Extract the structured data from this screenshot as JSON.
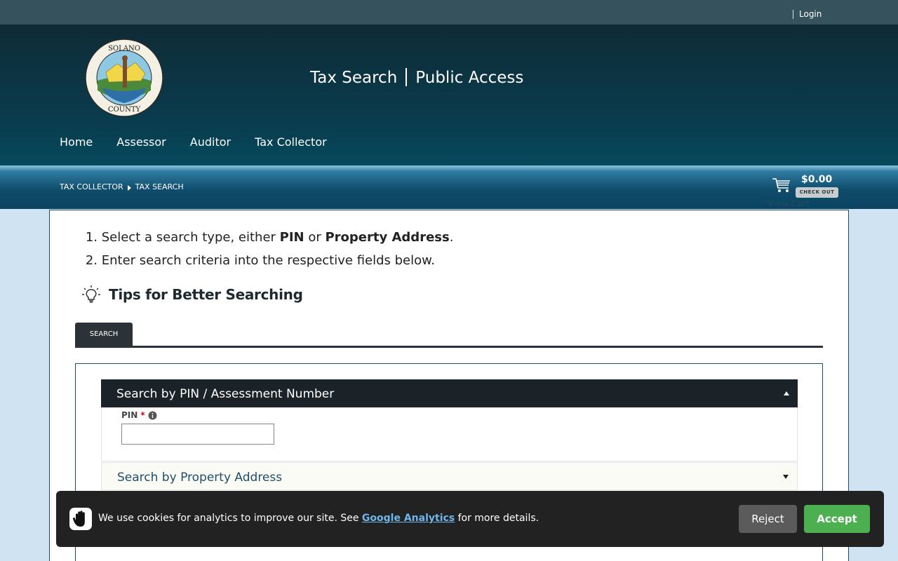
{
  "topbar": {
    "login_label": "Login"
  },
  "header": {
    "title_left": "Tax Search",
    "title_right": "Public Access",
    "logo_text_top": "SOLANO",
    "logo_text_bottom": "COUNTY"
  },
  "nav": {
    "items": [
      {
        "label": "Home"
      },
      {
        "label": "Assessor"
      },
      {
        "label": "Auditor"
      },
      {
        "label": "Tax Collector"
      }
    ]
  },
  "breadcrumb": {
    "items": [
      {
        "label": "TAX COLLECTOR"
      },
      {
        "label": "TAX SEARCH"
      }
    ]
  },
  "cart": {
    "amount": "$0.00",
    "checkout_label": "CHECK OUT",
    "view_label": "View Cart"
  },
  "instructions": {
    "step1": {
      "num": "1.",
      "prefix": "Select a search type, either ",
      "bold1": "PIN",
      "middle": " or ",
      "bold2": "Property Address",
      "suffix": "."
    },
    "step2": {
      "num": "2.",
      "text": "Enter search criteria into the respective fields below."
    }
  },
  "tips": {
    "label": "Tips for Better Searching"
  },
  "tabs": {
    "search_label": "SEARCH"
  },
  "panels": {
    "pin": {
      "title": "Search by PIN / Assessment Number",
      "field_label": "PIN",
      "required_mark": "*",
      "value": ""
    },
    "address": {
      "title": "Search by Property Address"
    }
  },
  "cookie": {
    "text_before": "We use cookies for analytics to improve our site. See ",
    "link_label": "Google Analytics",
    "text_after": " for more details.",
    "reject_label": "Reject",
    "accept_label": "Accept"
  },
  "colors": {
    "header_bg": "#093c4e",
    "topbar_bg": "#35525d",
    "accept": "#4caf50",
    "reject": "#5b5b5b",
    "panel_dark": "#1b2328",
    "link": "#6fb7ea"
  }
}
